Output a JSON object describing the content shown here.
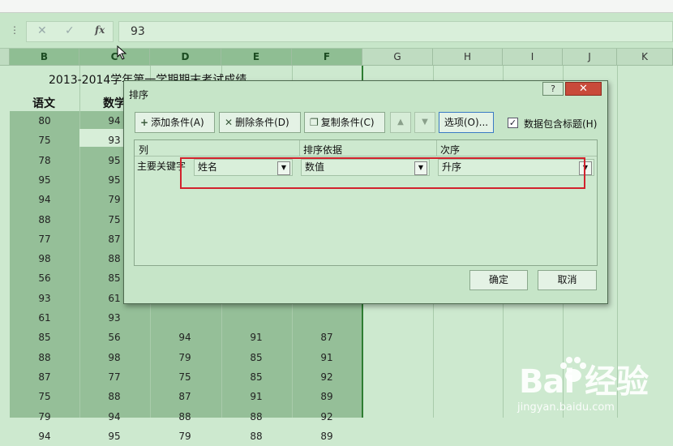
{
  "formula_bar": {
    "value": "93",
    "fx": "fx",
    "cancel": "✕",
    "enter": "✓"
  },
  "columns": [
    "B",
    "C",
    "D",
    "E",
    "F",
    "G",
    "H",
    "I",
    "J",
    "K"
  ],
  "sheet": {
    "title": "2013-2014学年第一学期期末考试成绩",
    "headers": [
      "语文",
      "数学"
    ],
    "col_b": [
      "80",
      "75",
      "78",
      "95",
      "94",
      "88",
      "77",
      "98",
      "56",
      "93",
      "61",
      "85",
      "88",
      "87",
      "75",
      "79",
      "94"
    ],
    "col_c": [
      "94",
      "93",
      "95",
      "95",
      "79",
      "75",
      "87",
      "88",
      "85",
      "61",
      "93",
      "56",
      "98",
      "77",
      "88",
      "94",
      "95"
    ],
    "rows_lower": [
      {
        "d": "94",
        "e": "91",
        "f": "87"
      },
      {
        "d": "79",
        "e": "85",
        "f": "91"
      },
      {
        "d": "75",
        "e": "85",
        "f": "92"
      },
      {
        "d": "87",
        "e": "91",
        "f": "89"
      },
      {
        "d": "88",
        "e": "88",
        "f": "92"
      },
      {
        "d": "79",
        "e": "88",
        "f": "89"
      }
    ]
  },
  "dialog": {
    "title": "排序",
    "help": "?",
    "close": "✕",
    "add_condition": "添加条件(A)",
    "delete_condition": "删除条件(D)",
    "copy_condition": "复制条件(C)",
    "options": "选项(O)...",
    "has_header_checked": true,
    "has_header_label": "数据包含标题(H)",
    "grid_headers": {
      "column": "列",
      "sort_on": "排序依据",
      "order": "次序"
    },
    "row": {
      "label": "主要关键字",
      "column": "姓名",
      "sort_on": "数值",
      "order": "升序"
    },
    "ok": "确定",
    "cancel": "取消"
  },
  "watermark": {
    "brand": "Bai  经验",
    "url": "jingyan.baidu.com"
  },
  "colors": {
    "sheet_bg": "#cde9cf",
    "selection": "#95bf98",
    "highlight": "#d2222d",
    "close": "#c94a3a"
  }
}
